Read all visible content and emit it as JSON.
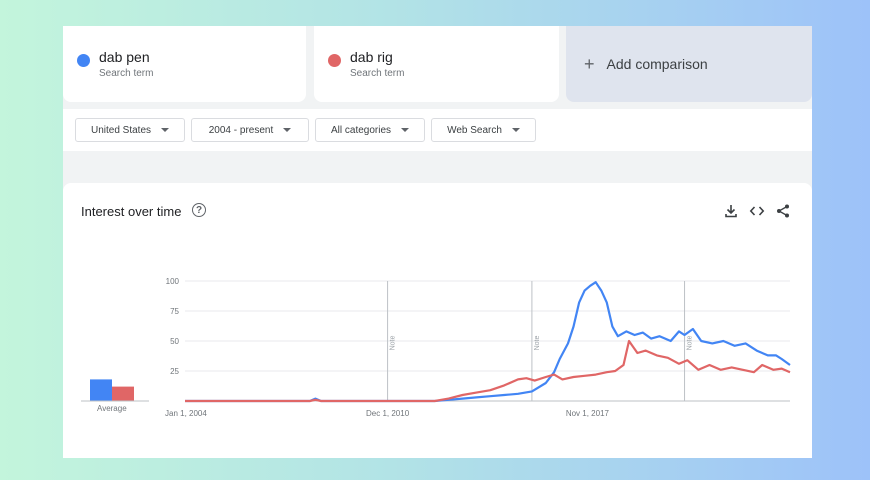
{
  "terms": [
    {
      "name": "dab pen",
      "sub": "Search term",
      "color": "#4285f4"
    },
    {
      "name": "dab rig",
      "sub": "Search term",
      "color": "#e06666"
    }
  ],
  "add_comparison": "Add comparison",
  "filters": [
    "United States",
    "2004 - present",
    "All categories",
    "Web Search"
  ],
  "card": {
    "title": "Interest over time",
    "help": "?",
    "icons": [
      "download-icon",
      "embed-icon",
      "share-icon"
    ]
  },
  "average_label": "Average",
  "chart_data": {
    "type": "line",
    "x_labels": [
      "Jan 1, 2004",
      "Dec 1, 2010",
      "Nov 1, 2017"
    ],
    "y_ticks": [
      25,
      50,
      75,
      100
    ],
    "ylim": [
      0,
      100
    ],
    "notes": [
      "Note",
      "Note",
      "Note"
    ],
    "averages": [
      {
        "series": "dab pen",
        "value": 18
      },
      {
        "series": "dab rig",
        "value": 12
      }
    ],
    "series": [
      {
        "name": "dab pen",
        "color": "#4285f4",
        "points": [
          [
            2004.0,
            0
          ],
          [
            2008.5,
            0
          ],
          [
            2008.7,
            2
          ],
          [
            2008.9,
            0
          ],
          [
            2013.0,
            0
          ],
          [
            2013.5,
            1
          ],
          [
            2014.0,
            2
          ],
          [
            2014.5,
            3
          ],
          [
            2015.0,
            4
          ],
          [
            2015.5,
            5
          ],
          [
            2016.0,
            6
          ],
          [
            2016.5,
            8
          ],
          [
            2017.0,
            15
          ],
          [
            2017.3,
            24
          ],
          [
            2017.5,
            35
          ],
          [
            2017.8,
            48
          ],
          [
            2018.0,
            62
          ],
          [
            2018.2,
            82
          ],
          [
            2018.4,
            92
          ],
          [
            2018.6,
            96
          ],
          [
            2018.8,
            99
          ],
          [
            2019.0,
            92
          ],
          [
            2019.2,
            82
          ],
          [
            2019.4,
            62
          ],
          [
            2019.6,
            54
          ],
          [
            2019.9,
            58
          ],
          [
            2020.2,
            55
          ],
          [
            2020.5,
            57
          ],
          [
            2020.8,
            52
          ],
          [
            2021.1,
            54
          ],
          [
            2021.5,
            50
          ],
          [
            2021.8,
            58
          ],
          [
            2022.0,
            55
          ],
          [
            2022.3,
            60
          ],
          [
            2022.6,
            50
          ],
          [
            2023.0,
            48
          ],
          [
            2023.4,
            50
          ],
          [
            2023.8,
            46
          ],
          [
            2024.2,
            48
          ],
          [
            2024.6,
            42
          ],
          [
            2025.0,
            38
          ],
          [
            2025.3,
            38
          ],
          [
            2025.5,
            35
          ],
          [
            2025.8,
            30
          ]
        ]
      },
      {
        "name": "dab rig",
        "color": "#e06666",
        "points": [
          [
            2004.0,
            0
          ],
          [
            2008.5,
            0
          ],
          [
            2008.7,
            1
          ],
          [
            2008.9,
            0
          ],
          [
            2013.0,
            0
          ],
          [
            2013.5,
            2
          ],
          [
            2014.0,
            5
          ],
          [
            2014.5,
            7
          ],
          [
            2015.0,
            9
          ],
          [
            2015.5,
            13
          ],
          [
            2016.0,
            18
          ],
          [
            2016.3,
            19
          ],
          [
            2016.6,
            17
          ],
          [
            2017.0,
            20
          ],
          [
            2017.3,
            22
          ],
          [
            2017.6,
            18
          ],
          [
            2018.0,
            20
          ],
          [
            2018.4,
            21
          ],
          [
            2018.8,
            22
          ],
          [
            2019.2,
            24
          ],
          [
            2019.5,
            25
          ],
          [
            2019.8,
            30
          ],
          [
            2020.0,
            50
          ],
          [
            2020.3,
            40
          ],
          [
            2020.6,
            42
          ],
          [
            2021.0,
            38
          ],
          [
            2021.4,
            36
          ],
          [
            2021.8,
            31
          ],
          [
            2022.1,
            34
          ],
          [
            2022.5,
            26
          ],
          [
            2022.9,
            30
          ],
          [
            2023.3,
            26
          ],
          [
            2023.7,
            28
          ],
          [
            2024.1,
            26
          ],
          [
            2024.5,
            24
          ],
          [
            2024.8,
            30
          ],
          [
            2025.2,
            26
          ],
          [
            2025.5,
            27
          ],
          [
            2025.8,
            24
          ]
        ]
      }
    ]
  }
}
